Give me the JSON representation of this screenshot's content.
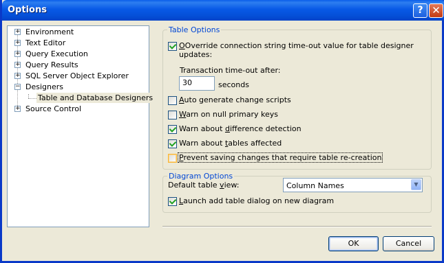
{
  "window": {
    "title": "Options",
    "help_symbol": "?",
    "close_symbol": "✕"
  },
  "tree": {
    "items": [
      {
        "label": "Environment",
        "expander": "+"
      },
      {
        "label": "Text Editor",
        "expander": "+"
      },
      {
        "label": "Query Execution",
        "expander": "+"
      },
      {
        "label": "Query Results",
        "expander": "+"
      },
      {
        "label": "SQL Server Object Explorer",
        "expander": "+"
      },
      {
        "label": "Designers",
        "expander": "−"
      },
      {
        "label": "Table and Database Designers"
      },
      {
        "label": "Source Control",
        "expander": "+"
      }
    ]
  },
  "table_options": {
    "legend": "Table Options",
    "override_line1": "Override connection string time-out value for table designer",
    "override_line2": "updates:",
    "timeout_label": "Transaction time-out after:",
    "timeout_value": "30",
    "timeout_unit": "seconds",
    "auto_generate_pre": "",
    "auto_generate_key": "A",
    "auto_generate_post": "uto generate change scripts",
    "warn_null_pre": "",
    "warn_null_key": "W",
    "warn_null_post": "arn on null primary keys",
    "warn_diff_pre": "Warn about ",
    "warn_diff_key": "d",
    "warn_diff_post": "ifference detection",
    "warn_tables_pre": "Warn about ",
    "warn_tables_key": "t",
    "warn_tables_post": "ables affected",
    "prevent_pre": "",
    "prevent_key": "P",
    "prevent_post": "revent saving changes that require table re-creation",
    "checked": {
      "override": true,
      "auto_generate": false,
      "warn_null": false,
      "warn_diff": true,
      "warn_tables": true,
      "prevent": false
    }
  },
  "diagram_options": {
    "legend": "Diagram Options",
    "default_view_pre": "Default table ",
    "default_view_key": "v",
    "default_view_post": "iew:",
    "default_view_value": "Column Names",
    "launch_pre": "",
    "launch_key": "L",
    "launch_post": "aunch add table dialog on new diagram",
    "checked": {
      "launch": true
    }
  },
  "buttons": {
    "ok": "OK",
    "cancel": "Cancel"
  }
}
